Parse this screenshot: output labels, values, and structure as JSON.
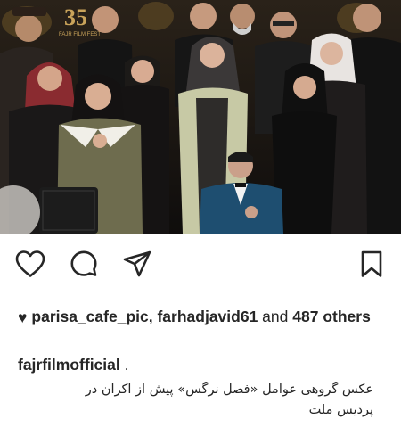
{
  "photo": {
    "description_icon": "group-photo",
    "backdrop_labels": [
      "35",
      "FAJR FILM FEST"
    ]
  },
  "actions": {
    "like_icon": "heart-icon",
    "comment_icon": "comment-icon",
    "share_icon": "send-icon",
    "save_icon": "bookmark-icon"
  },
  "likes": {
    "heart_glyph": "♥",
    "user1": "parisa_cafe_pic,",
    "user2": "farhadjavid61",
    "connector": "and",
    "count_text": "487",
    "others": "others"
  },
  "caption": {
    "username": "fajrfilmofficial",
    "dot": ".",
    "line1": "عکس گروهی عوامل «فصل نرگس» پیش از اکران در",
    "line2": "پردیس ملت"
  },
  "colors": {
    "text": "#262626",
    "background": "#ffffff",
    "photo_backdrop": "#1b1714"
  }
}
